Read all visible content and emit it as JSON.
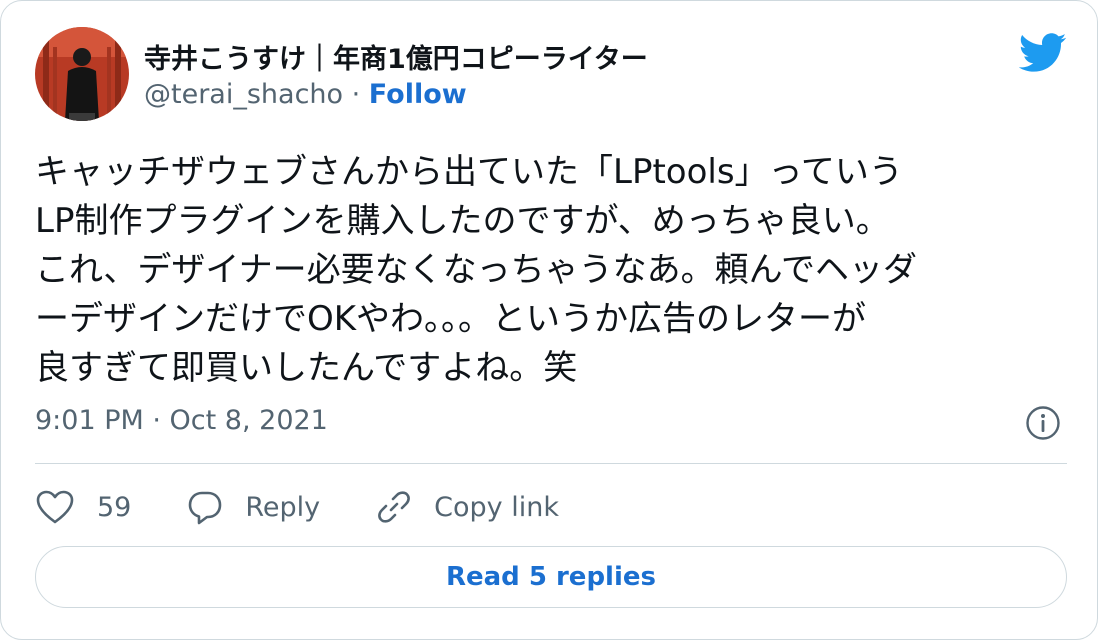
{
  "author": {
    "display_name": "寺井こうすけ｜年商1億円コピーライター",
    "handle": "@terai_shacho",
    "separator": " · ",
    "follow_label": "Follow"
  },
  "tweet": {
    "lines": [
      "キャッチザウェブさんから出ていた「LPtools」っていう",
      "LP制作プラグインを購入したのですが、めっちゃ良い。",
      "これ、デザイナー必要なくなっちゃうなあ。頼んでヘッダ",
      "ーデザインだけでOKやわ。。。というか広告のレターが",
      "良すぎて即買いしたんですよね。笑"
    ],
    "timestamp": "9:01 PM · Oct 8, 2021"
  },
  "actions": {
    "like_count": "59",
    "reply_label": "Reply",
    "copy_link_label": "Copy link"
  },
  "read_replies_label": "Read 5 replies",
  "icons": {
    "brand": "twitter-bird-icon",
    "info": "info-icon",
    "like": "heart-icon",
    "reply": "speech-bubble-icon",
    "copy": "link-icon"
  },
  "colors": {
    "brand_blue": "#1d9bf0",
    "link_blue": "#1b6fd0",
    "text": "#0f1419",
    "secondary": "#536471",
    "border": "#cfd9de"
  }
}
